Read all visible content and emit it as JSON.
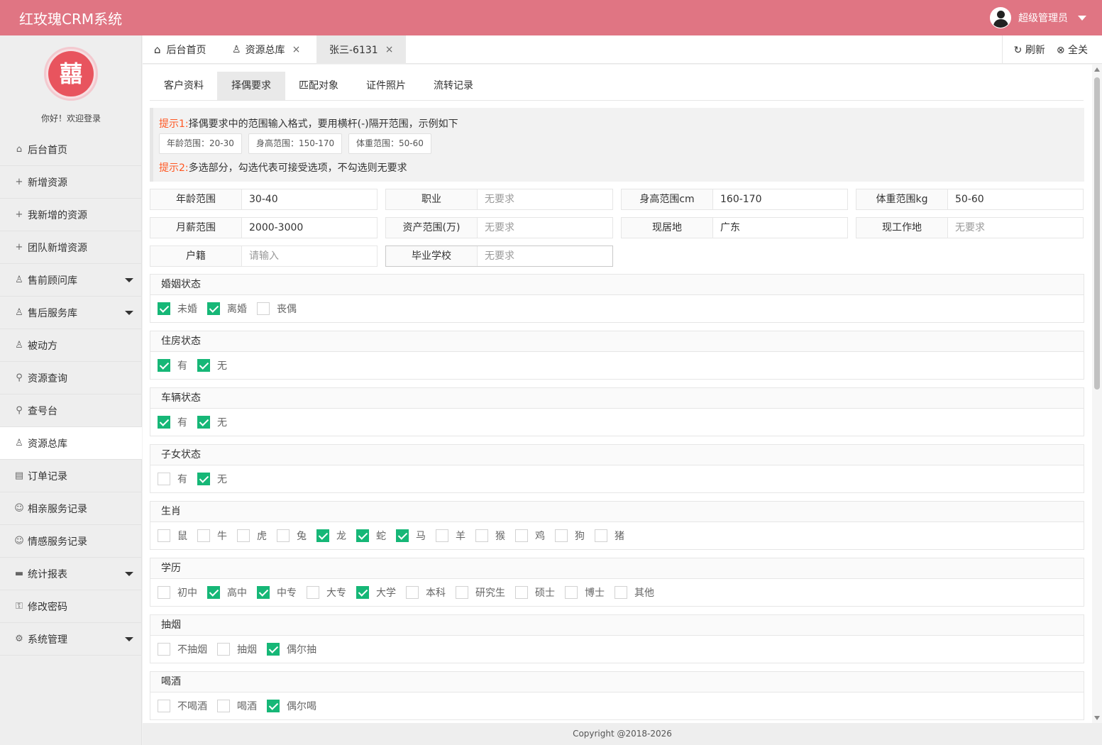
{
  "app": {
    "title": "红玫瑰CRM系统",
    "user_name": "超级管理员"
  },
  "sidebar": {
    "logo_glyph": "囍",
    "welcome": "你好！欢迎登录",
    "items": [
      {
        "label": "后台首页",
        "icon": "⌂"
      },
      {
        "label": "新增资源",
        "icon": "+"
      },
      {
        "label": "我新增的资源",
        "icon": "+"
      },
      {
        "label": "团队新增资源",
        "icon": "+"
      },
      {
        "label": "售前顾问库",
        "icon": "♙"
      },
      {
        "label": "售后服务库",
        "icon": "♙"
      },
      {
        "label": "被动方",
        "icon": "♙"
      },
      {
        "label": "资源查询",
        "icon": "⚲"
      },
      {
        "label": "查号台",
        "icon": "⚲"
      },
      {
        "label": "资源总库",
        "icon": "♙"
      },
      {
        "label": "订单记录",
        "icon": "▤"
      },
      {
        "label": "相亲服务记录",
        "icon": "☺"
      },
      {
        "label": "情感服务记录",
        "icon": "☺"
      },
      {
        "label": "统计报表",
        "icon": "▬"
      },
      {
        "label": "修改密码",
        "icon": "⚿"
      },
      {
        "label": "系统管理",
        "icon": "⚙"
      }
    ]
  },
  "tabs": {
    "items": [
      {
        "label": "后台首页",
        "icon": "⌂"
      },
      {
        "label": "资源总库",
        "icon": "♙",
        "close": "×"
      },
      {
        "label": "张三-6131",
        "close": "×"
      }
    ],
    "refresh": "刷新",
    "refresh_icon": "↻",
    "close_all": "全关",
    "close_all_icon": "⊗"
  },
  "subtabs": [
    "客户资料",
    "择偶要求",
    "匹配对象",
    "证件照片",
    "流转记录"
  ],
  "notice": {
    "tip1_label": "提示1:",
    "tip1_text": "择偶要求中的范围输入格式，要用横杆(-)隔开范围，示例如下",
    "chips": [
      "年龄范围：20-30",
      "身高范围：150-170",
      "体重范围：50-60"
    ],
    "tip2_label": "提示2:",
    "tip2_text": "多选部分，勾选代表可接受选项，不勾选则无要求"
  },
  "fields": [
    {
      "label": "年龄范围",
      "value": "30-40",
      "placeholder": ""
    },
    {
      "label": "职业",
      "value": "",
      "placeholder": "无要求"
    },
    {
      "label": "身高范围cm",
      "value": "160-170",
      "placeholder": ""
    },
    {
      "label": "体重范围kg",
      "value": "50-60",
      "placeholder": ""
    },
    {
      "label": "月薪范围",
      "value": "2000-3000",
      "placeholder": ""
    },
    {
      "label": "资产范围(万)",
      "value": "",
      "placeholder": "无要求"
    },
    {
      "label": "现居地",
      "value": "广东",
      "placeholder": ""
    },
    {
      "label": "现工作地",
      "value": "",
      "placeholder": "无要求"
    },
    {
      "label": "户籍",
      "value": "",
      "placeholder": "请输入"
    },
    {
      "label": "毕业学校",
      "value": "",
      "placeholder": "无要求"
    }
  ],
  "sections": [
    {
      "title": "婚姻状态",
      "options": [
        {
          "label": "未婚",
          "checked": true
        },
        {
          "label": "离婚",
          "checked": true
        },
        {
          "label": "丧偶",
          "checked": false
        }
      ]
    },
    {
      "title": "住房状态",
      "options": [
        {
          "label": "有",
          "checked": true
        },
        {
          "label": "无",
          "checked": true
        }
      ]
    },
    {
      "title": "车辆状态",
      "options": [
        {
          "label": "有",
          "checked": true
        },
        {
          "label": "无",
          "checked": true
        }
      ]
    },
    {
      "title": "子女状态",
      "options": [
        {
          "label": "有",
          "checked": false
        },
        {
          "label": "无",
          "checked": true
        }
      ]
    },
    {
      "title": "生肖",
      "options": [
        {
          "label": "鼠",
          "checked": false
        },
        {
          "label": "牛",
          "checked": false
        },
        {
          "label": "虎",
          "checked": false
        },
        {
          "label": "兔",
          "checked": false
        },
        {
          "label": "龙",
          "checked": true
        },
        {
          "label": "蛇",
          "checked": true
        },
        {
          "label": "马",
          "checked": true
        },
        {
          "label": "羊",
          "checked": false
        },
        {
          "label": "猴",
          "checked": false
        },
        {
          "label": "鸡",
          "checked": false
        },
        {
          "label": "狗",
          "checked": false
        },
        {
          "label": "猪",
          "checked": false
        }
      ]
    },
    {
      "title": "学历",
      "options": [
        {
          "label": "初中",
          "checked": false
        },
        {
          "label": "高中",
          "checked": true
        },
        {
          "label": "中专",
          "checked": true
        },
        {
          "label": "大专",
          "checked": false
        },
        {
          "label": "大学",
          "checked": true
        },
        {
          "label": "本科",
          "checked": false
        },
        {
          "label": "研究生",
          "checked": false
        },
        {
          "label": "硕士",
          "checked": false
        },
        {
          "label": "博士",
          "checked": false
        },
        {
          "label": "其他",
          "checked": false
        }
      ]
    },
    {
      "title": "抽烟",
      "options": [
        {
          "label": "不抽烟",
          "checked": false
        },
        {
          "label": "抽烟",
          "checked": false
        },
        {
          "label": "偶尔抽",
          "checked": true
        }
      ]
    },
    {
      "title": "喝酒",
      "options": [
        {
          "label": "不喝酒",
          "checked": false
        },
        {
          "label": "喝酒",
          "checked": false
        },
        {
          "label": "偶尔喝",
          "checked": true
        }
      ]
    }
  ],
  "footer": {
    "copyright": "Copyright @2018-2026"
  },
  "colors": {
    "header": "#e07583",
    "check": "#16b777",
    "hint": "#ff5722"
  }
}
